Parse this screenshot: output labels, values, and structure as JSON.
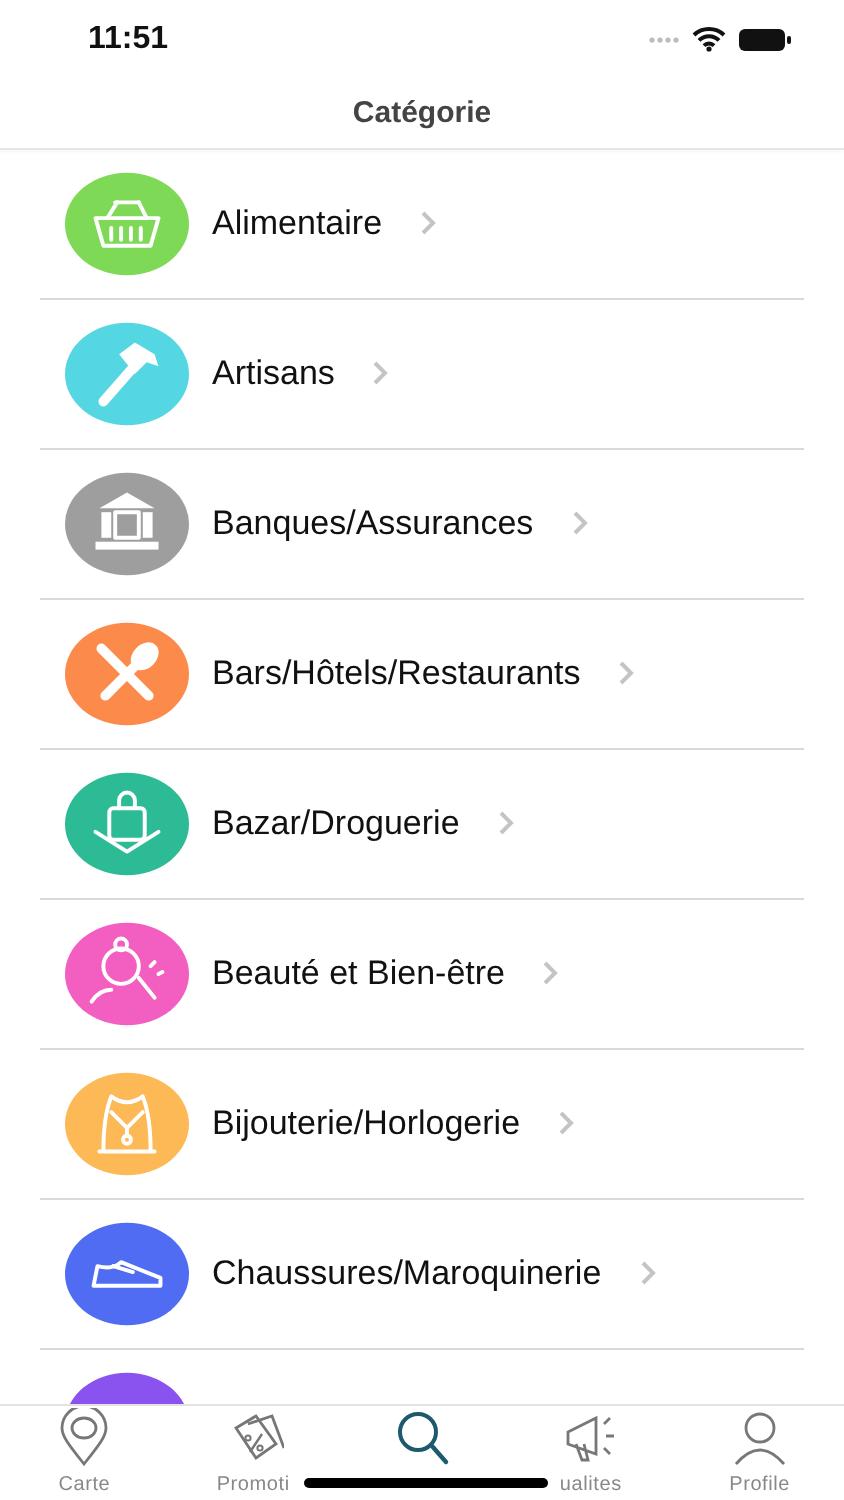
{
  "status_bar": {
    "time": "11:51"
  },
  "header": {
    "title": "Catégorie"
  },
  "categories": [
    {
      "label": "Alimentaire",
      "color": "#7ed957"
    },
    {
      "label": "Artisans",
      "color": "#55d6e3"
    },
    {
      "label": "Banques/Assurances",
      "color": "#9e9e9e"
    },
    {
      "label": "Bars/Hôtels/Restaurants",
      "color": "#fb8a4b"
    },
    {
      "label": "Bazar/Droguerie",
      "color": "#2dbb96"
    },
    {
      "label": "Beauté et Bien-être",
      "color": "#f25fc0"
    },
    {
      "label": "Bijouterie/Horlogerie",
      "color": "#fdb956"
    },
    {
      "label": "Chaussures/Maroquinerie",
      "color": "#4f6cf2"
    },
    {
      "color": "#8a52ee"
    }
  ],
  "tab_bar": [
    {
      "label": "Carte",
      "selected": false
    },
    {
      "label": "Promoti",
      "selected": false
    },
    {
      "selected": true
    },
    {
      "label": "ualites",
      "selected": false
    },
    {
      "label": "Profile",
      "selected": false
    }
  ]
}
